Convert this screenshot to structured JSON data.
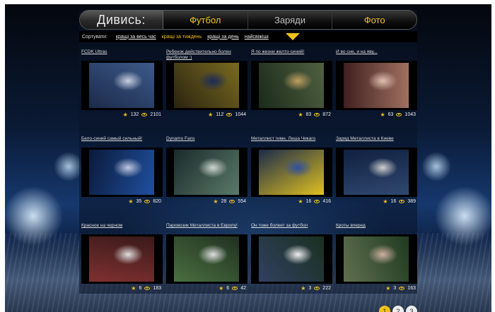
{
  "nav": {
    "brand": "Дивись:",
    "tabs": [
      {
        "label": "Футбол"
      },
      {
        "label": "Заряди"
      },
      {
        "label": "Фото"
      }
    ]
  },
  "sort": {
    "label": "Сортувати:",
    "options": [
      {
        "label": "кращі за весь час"
      },
      {
        "label": "кращі за тиждень"
      },
      {
        "label": "кращі за день"
      },
      {
        "label": "найсвіжіші"
      }
    ]
  },
  "videos": [
    {
      "title": "FCDK Ultras",
      "likes": "132",
      "views": "2101"
    },
    {
      "title": "Ребенок действительно болен футболом :)",
      "likes": "112",
      "views": "1044"
    },
    {
      "title": "Я по жизни желто-синий!",
      "likes": "83",
      "views": "872"
    },
    {
      "title": "И во сне, и на яву...",
      "likes": "63",
      "views": "1043"
    },
    {
      "title": "Бело-синий самый сильный!",
      "likes": "35",
      "views": "820"
    },
    {
      "title": "Dynamo Fans",
      "likes": "28",
      "views": "554"
    },
    {
      "title": "Металлист гимн, Леша Чикаго",
      "likes": "16",
      "views": "416"
    },
    {
      "title": "Заряд Металлиста в Киеве",
      "likes": "16",
      "views": "389"
    },
    {
      "title": "Красное на черном",
      "likes": "6",
      "views": "183"
    },
    {
      "title": "Паровозик Металлиста в Европу!",
      "likes": "6",
      "views": "42"
    },
    {
      "title": "Он тоже болеет за футбол",
      "likes": "3",
      "views": "222"
    },
    {
      "title": "Кроты вперед",
      "likes": "3",
      "views": "163"
    }
  ],
  "pager": {
    "pages": [
      "1",
      "2",
      "3"
    ]
  },
  "colors": {
    "accent": "#f2c21b",
    "nav_bg": "#0f0f0f"
  }
}
